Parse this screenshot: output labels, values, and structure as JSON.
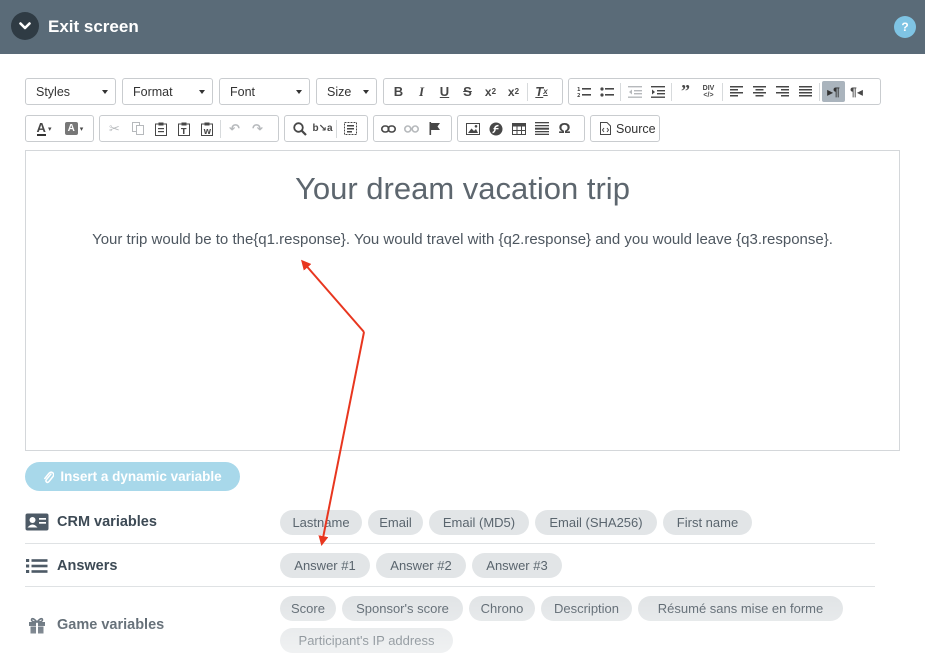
{
  "header": {
    "title": "Exit screen",
    "help_label": "?"
  },
  "toolbar": {
    "styles_label": "Styles",
    "format_label": "Format",
    "font_label": "Font",
    "size_label": "Size",
    "source_label": "Source"
  },
  "editor": {
    "title": "Your dream vacation trip",
    "body": "Your trip would be to the{q1.response}. You would travel with {q2.response} and you would leave {q3.response}."
  },
  "insert_button": {
    "label": "Insert a dynamic variable"
  },
  "crm": {
    "label": "CRM variables",
    "chips": [
      "Lastname",
      "Email",
      "Email (MD5)",
      "Email (SHA256)",
      "First name"
    ]
  },
  "answers": {
    "label": "Answers",
    "chips": [
      "Answer #1",
      "Answer #2",
      "Answer #3"
    ]
  },
  "game": {
    "label": "Game variables",
    "chips": [
      "Score",
      "Sponsor's score",
      "Chrono",
      "Description",
      "Résumé sans mise en forme",
      "Participant's IP address"
    ]
  },
  "colors": {
    "header_bg": "#5a6b78",
    "accent_light_blue": "#a8d8ea",
    "chip_bg": "#e2e5e7",
    "annotation_arrow": "#e8361f"
  }
}
